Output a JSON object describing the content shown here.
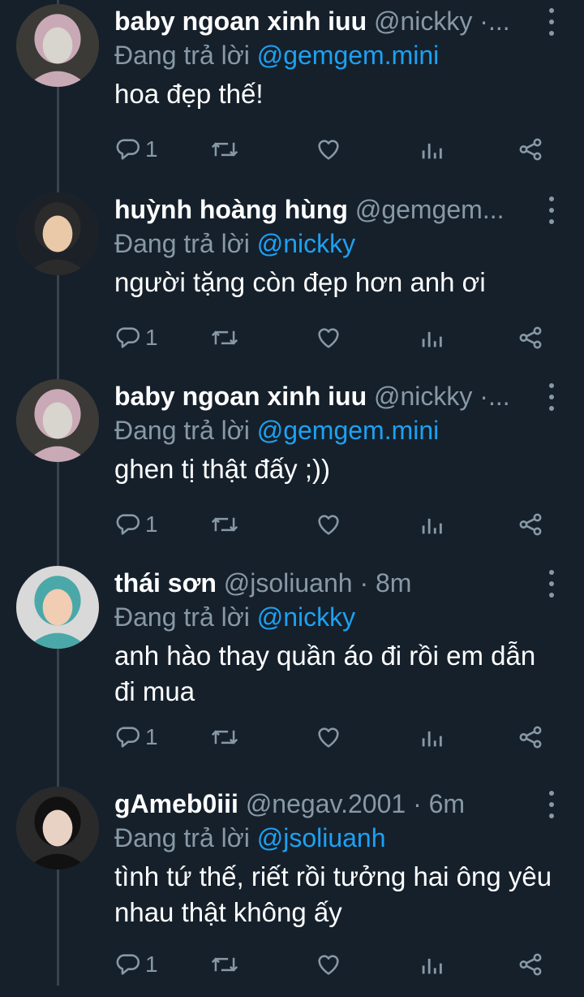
{
  "tweets": [
    {
      "name": "baby ngoan xinh iuu",
      "handle_time": "@nickky ·...",
      "reply_prefix": "Đang trả lời",
      "reply_to": "@gemgem.mini",
      "text": "hoa đẹp thế!",
      "reply_count": "1",
      "avatar_colors": [
        "#3b3a36",
        "#d8d4ce",
        "#c9a9b6"
      ]
    },
    {
      "name": "huỳnh hoàng hùng",
      "handle_time": "@gemgem...",
      "reply_prefix": "Đang trả lời",
      "reply_to": "@nickky",
      "text": "người tặng còn đẹp hơn anh ơi",
      "reply_count": "1",
      "avatar_colors": [
        "#1c2128",
        "#e9c9a8",
        "#2b2b2b"
      ]
    },
    {
      "name": "baby ngoan xinh iuu",
      "handle_time": "@nickky ·...",
      "reply_prefix": "Đang trả lời",
      "reply_to": "@gemgem.mini",
      "text": "ghen tị thật đấy ;))",
      "reply_count": "1",
      "avatar_colors": [
        "#3b3a36",
        "#d8d4ce",
        "#c9a9b6"
      ]
    },
    {
      "name": "thái sơn",
      "handle_time": "@jsoliuanh · 8m",
      "reply_prefix": "Đang trả lời",
      "reply_to": "@nickky",
      "text": "anh hào thay quần áo  đi rồi em dẫn đi mua",
      "reply_count": "1",
      "avatar_colors": [
        "#d9d9d9",
        "#f0cdb3",
        "#4aa8a8"
      ]
    },
    {
      "name": "gAmeb0iii",
      "handle_time": "@negav.2001 · 6m",
      "reply_prefix": "Đang trả lời",
      "reply_to": "@jsoliuanh",
      "text": "tình tứ thế, riết rồi tưởng hai ông yêu nhau thật không ấy",
      "reply_count": "1",
      "avatar_colors": [
        "#2a2a2a",
        "#e8d2c4",
        "#111111"
      ]
    }
  ],
  "icons": {
    "reply": "reply-icon",
    "retweet": "retweet-icon",
    "like": "heart-icon",
    "analytics": "analytics-icon",
    "share": "share-icon",
    "more": "more-vertical-icon"
  },
  "colors": {
    "background": "#15202b",
    "text": "#ffffff",
    "secondary": "#8899a6",
    "mention": "#1da1f2",
    "thread_line": "#38444d"
  }
}
